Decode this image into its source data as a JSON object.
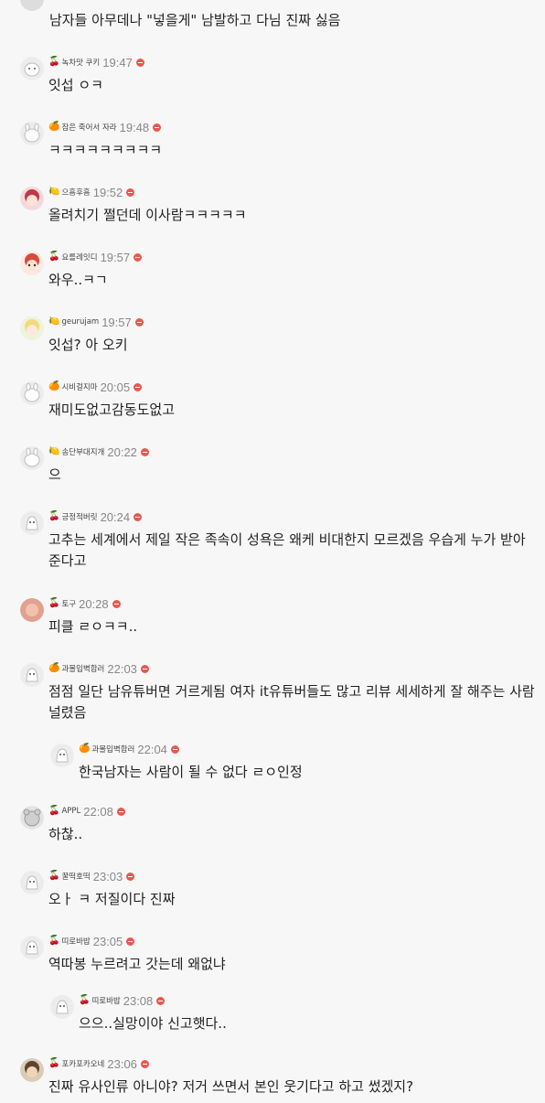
{
  "colors": {
    "background": "#f7f7f7",
    "reply_button": "#e8584f",
    "time": "#888888",
    "text": "#222222"
  },
  "top_partial": {
    "text": "남자들 아무데나 \"넣을게\" 남발하고 다님 진짜 싫음"
  },
  "comments": [
    {
      "badge": "🍒",
      "nick": "녹차맛 쿠키",
      "time": "19:47",
      "lines": [
        "잇섭 ㅇㅋ"
      ]
    },
    {
      "badge": "🍊",
      "nick": "잠은 죽어서 자라",
      "time": "19:48",
      "lines": [
        "ㅋㅋㅋㅋㅋㅋㅋㅋㅋ"
      ]
    },
    {
      "badge": "🍋",
      "nick": "으흠후흠",
      "time": "19:52",
      "lines": [
        "올려치기 쩔던데 이사람ㅋㅋㅋㅋㅋ"
      ]
    },
    {
      "badge": "🍒",
      "nick": "요를레잇디",
      "time": "19:57",
      "lines": [
        "와우..ㅋㄱ"
      ]
    },
    {
      "badge": "🍋",
      "nick": "geurujam",
      "time": "19:57",
      "lines": [
        "잇섭? 아 오키"
      ]
    },
    {
      "badge": "🍊",
      "nick": "시비걸지마",
      "time": "20:05",
      "lines": [
        "재미도없고감동도없고"
      ]
    },
    {
      "badge": "🍋",
      "nick": "송단부대지개",
      "time": "20:22",
      "lines": [
        "으"
      ]
    },
    {
      "badge": "🍒",
      "nick": "긍정적버릿",
      "time": "20:24",
      "lines": [
        "고추는 세계에서 제일 작은 족속이 성욕은 왜케 비대한지 모르겠음 우습게 누가 받아",
        "준다고"
      ]
    },
    {
      "badge": "🍒",
      "nick": "토구",
      "time": "20:28",
      "lines": [
        "피클 ㄹㅇㅋㅋ.."
      ]
    },
    {
      "badge": "🍊",
      "nick": "과몰입벽합러",
      "time": "22:03",
      "lines": [
        "점점 일단 남유튜버면 거르게됨 여자 it유튜버들도 많고 리뷰 세세하게 잘 해주는 사람",
        "널렸음"
      ]
    },
    {
      "badge": "🍊",
      "nick": "과몰입벽합러",
      "time": "22:04",
      "lines": [
        "한국남자는 사람이 될 수 없다 ㄹㅇ인정"
      ],
      "reply": true
    },
    {
      "badge": "🍒",
      "nick": "APPL",
      "time": "22:08",
      "lines": [
        "하찮.."
      ]
    },
    {
      "badge": "🍒",
      "nick": "꿀떡호떡",
      "time": "23:03",
      "lines": [
        "오ㅏ ㅋ 저질이다 진짜"
      ]
    },
    {
      "badge": "🍒",
      "nick": "띠로바밥",
      "time": "23:05",
      "lines": [
        "역따봉 누르려고 갓는데 왜없냐"
      ]
    },
    {
      "badge": "🍒",
      "nick": "띠로바밥",
      "time": "23:08",
      "lines": [
        "으으..실망이야 신고햇다.."
      ],
      "reply": true
    },
    {
      "badge": "🍒",
      "nick": "포카포카오네",
      "time": "23:06",
      "lines": [
        "진짜 유사인류 아니야? 저거 쓰면서 본인 웃기다고 하고 썼겠지?"
      ]
    }
  ]
}
